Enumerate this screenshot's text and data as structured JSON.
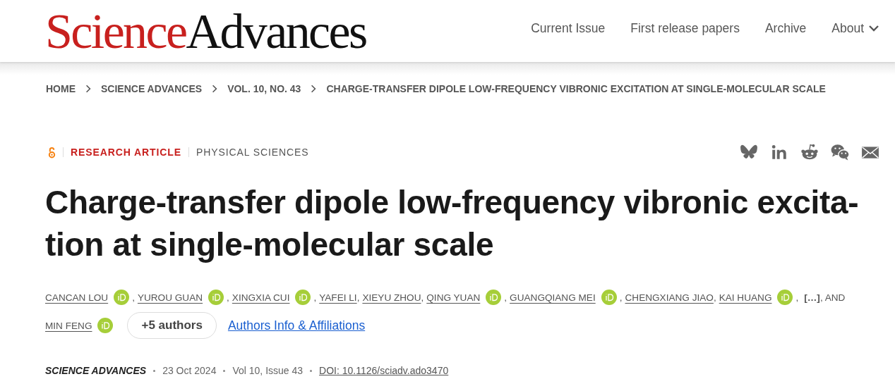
{
  "header": {
    "logo": {
      "part_1": "Science",
      "part_2": "Advances"
    },
    "nav": [
      {
        "label": "Current Issue",
        "dropdown": false
      },
      {
        "label": "First release papers",
        "dropdown": false
      },
      {
        "label": "Archive",
        "dropdown": false
      },
      {
        "label": "About",
        "dropdown": true
      }
    ]
  },
  "breadcrumbs": [
    "HOME",
    "SCIENCE ADVANCES",
    "VOL. 10, NO. 43",
    "CHARGE-TRANSFER DIPOLE LOW-FREQUENCY VIBRONIC EXCITATION AT SINGLE-MOLECULAR SCALE"
  ],
  "article": {
    "open_access": true,
    "article_type": "RESEARCH ARTICLE",
    "subject": "PHYSICAL SCIENCES",
    "share": [
      {
        "kind": "bluesky"
      },
      {
        "kind": "linkedin"
      },
      {
        "kind": "reddit"
      },
      {
        "kind": "wechat"
      },
      {
        "kind": "email"
      }
    ],
    "title": "Charge-transfer dipole low-frequency vibronic excita-\ntion at single-molecular scale",
    "author_rows": [
      [
        {
          "kind": "author",
          "name": "CANCAN LOU",
          "orcid": true,
          "sep": ","
        },
        {
          "kind": "author",
          "name": "YUROU GUAN",
          "orcid": true,
          "sep": ","
        },
        {
          "kind": "author",
          "name": "XINGXIA CUI",
          "orcid": true,
          "sep": ","
        },
        {
          "kind": "author",
          "name": "YAFEI LI",
          "orcid": false,
          "sep": ","
        },
        {
          "kind": "author",
          "name": "XIEYU ZHOU",
          "orcid": false,
          "sep": ","
        },
        {
          "kind": "author",
          "name": "QING YUAN",
          "orcid": true,
          "sep": ","
        },
        {
          "kind": "author",
          "name": "GUANGQIANG MEI",
          "orcid": true,
          "sep": ","
        },
        {
          "kind": "author",
          "name": "CHENGXIANG JIAO",
          "orcid": false,
          "sep": ","
        },
        {
          "kind": "author",
          "name": "KAI HUANG",
          "orcid": true,
          "sep": ","
        },
        {
          "kind": "more",
          "name": "[…]",
          "orcid": false,
          "sep": ", AND"
        }
      ],
      [
        {
          "kind": "author",
          "name": "MIN FENG",
          "orcid": true
        }
      ]
    ],
    "more_authors_button": "+5 authors",
    "affiliations_link": "Authors Info & Affiliations",
    "meta": {
      "journal": "SCIENCE ADVANCES",
      "date": "23 Oct 2024",
      "issue": "Vol 10, Issue 43",
      "doi": "DOI: 10.1126/sciadv.ado3470"
    }
  }
}
